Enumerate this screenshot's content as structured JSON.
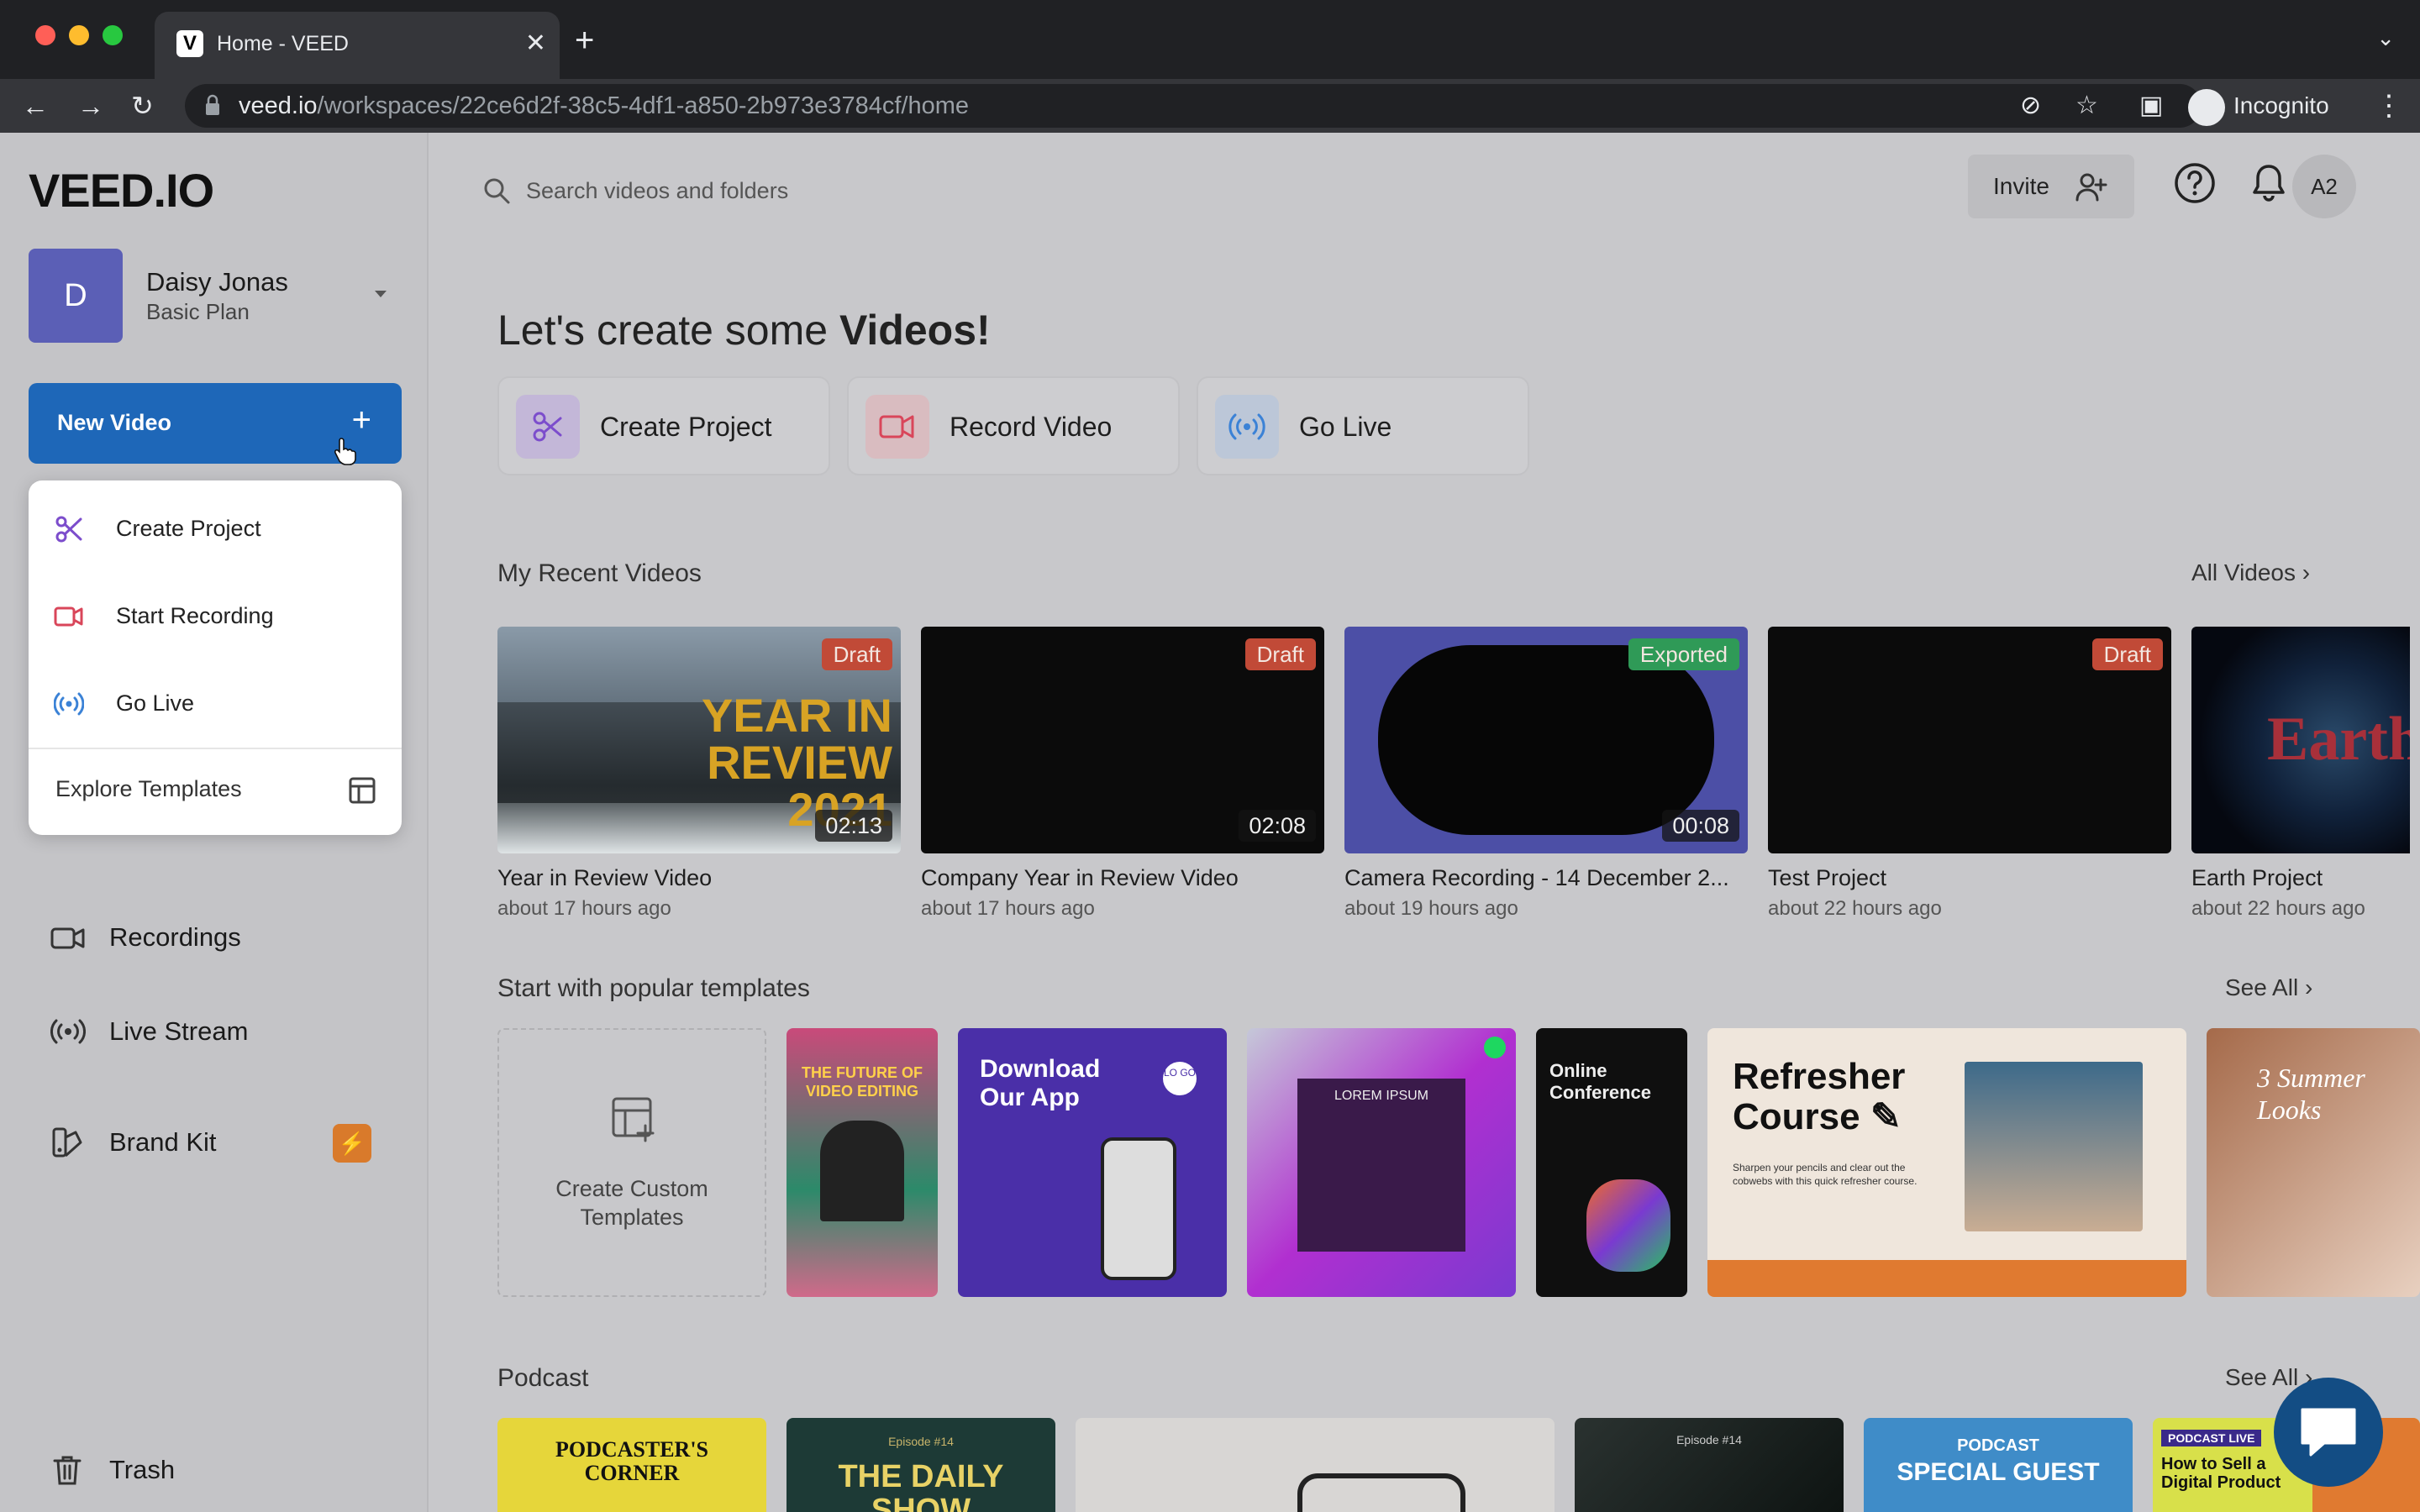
{
  "browser": {
    "tab_title": "Home - VEED",
    "tab_favicon": "V",
    "url_domain": "veed.io",
    "url_path": "/workspaces/22ce6d2f-38c5-4df1-a850-2b973e3784cf/home",
    "profile_label": "Incognito"
  },
  "sidebar": {
    "logo": "VEED.IO",
    "user": {
      "initial": "D",
      "name": "Daisy Jonas",
      "plan": "Basic Plan"
    },
    "new_video_label": "New Video",
    "new_video_plus": "+",
    "dropdown": {
      "items": [
        {
          "label": "Create Project",
          "icon": "scissors-icon"
        },
        {
          "label": "Start Recording",
          "icon": "video-camera-icon"
        },
        {
          "label": "Go Live",
          "icon": "broadcast-icon"
        }
      ],
      "footer_label": "Explore Templates",
      "footer_icon": "template-icon"
    },
    "nav": [
      {
        "label": "Recordings",
        "icon": "video-camera-icon"
      },
      {
        "label": "Live Stream",
        "icon": "broadcast-icon"
      },
      {
        "label": "Brand Kit",
        "icon": "brand-kit-icon",
        "badge": "⚡"
      },
      {
        "label": "Trash",
        "icon": "trash-icon"
      }
    ]
  },
  "header": {
    "search_placeholder": "Search videos and folders",
    "invite_label": "Invite",
    "account_initials": "A2"
  },
  "main": {
    "heading_prefix": "Let's create some ",
    "heading_bold": "Videos!",
    "quick_actions": [
      {
        "label": "Create Project",
        "icon": "scissors-icon",
        "color": "#7c4dcc"
      },
      {
        "label": "Record Video",
        "icon": "video-camera-icon",
        "color": "#d9465a"
      },
      {
        "label": "Go Live",
        "icon": "broadcast-icon",
        "color": "#3b82d6"
      }
    ],
    "recent": {
      "title": "My Recent Videos",
      "link": "All Videos",
      "videos": [
        {
          "title": "Year in Review Video",
          "time": "about 17 hours ago",
          "status": "Draft",
          "duration": "02:13",
          "thumb_text": "YEAR IN REVIEW 2021"
        },
        {
          "title": "Company Year in Review Video",
          "time": "about 17 hours ago",
          "status": "Draft",
          "duration": "02:08"
        },
        {
          "title": "Camera Recording - 14 December 2...",
          "time": "about 19 hours ago",
          "status": "Exported",
          "duration": "00:08"
        },
        {
          "title": "Test Project",
          "time": "about 22 hours ago",
          "status": "Draft"
        },
        {
          "title": "Earth Project",
          "time": "about 22 hours ago",
          "thumb_text": "Earth"
        }
      ]
    },
    "templates": {
      "title": "Start with popular templates",
      "link": "See All",
      "custom_label": "Create Custom Templates",
      "items": [
        {
          "text": "THE FUTURE OF VIDEO EDITING"
        },
        {
          "text": "Download Our App",
          "sub": "LO GO"
        },
        {
          "text": "LOREM IPSUM"
        },
        {
          "text": "Online Conference"
        },
        {
          "text": "Refresher Course ✎",
          "sub": "Sharpen your pencils and clear out the cobwebs with this quick refresher course."
        },
        {
          "text": "3 Summer Looks"
        }
      ]
    },
    "podcast": {
      "title": "Podcast",
      "link": "See All",
      "items": [
        {
          "text": "PODCASTER'S CORNER"
        },
        {
          "text": "THE DAILY SHOW",
          "sub": "Episode #14"
        },
        {
          "text": ""
        },
        {
          "text": "",
          "sub": "Episode #14"
        },
        {
          "text": "SPECIAL GUEST",
          "sub": "PODCAST"
        },
        {
          "text": "How to Sell a Digital Product",
          "sub": "PODCAST LIVE"
        }
      ]
    }
  },
  "colors": {
    "primary_button": "#1e67b8",
    "draft_badge": "#c14a37",
    "exported_badge": "#2f9a57",
    "brand_kit_badge": "#d97a2b"
  }
}
